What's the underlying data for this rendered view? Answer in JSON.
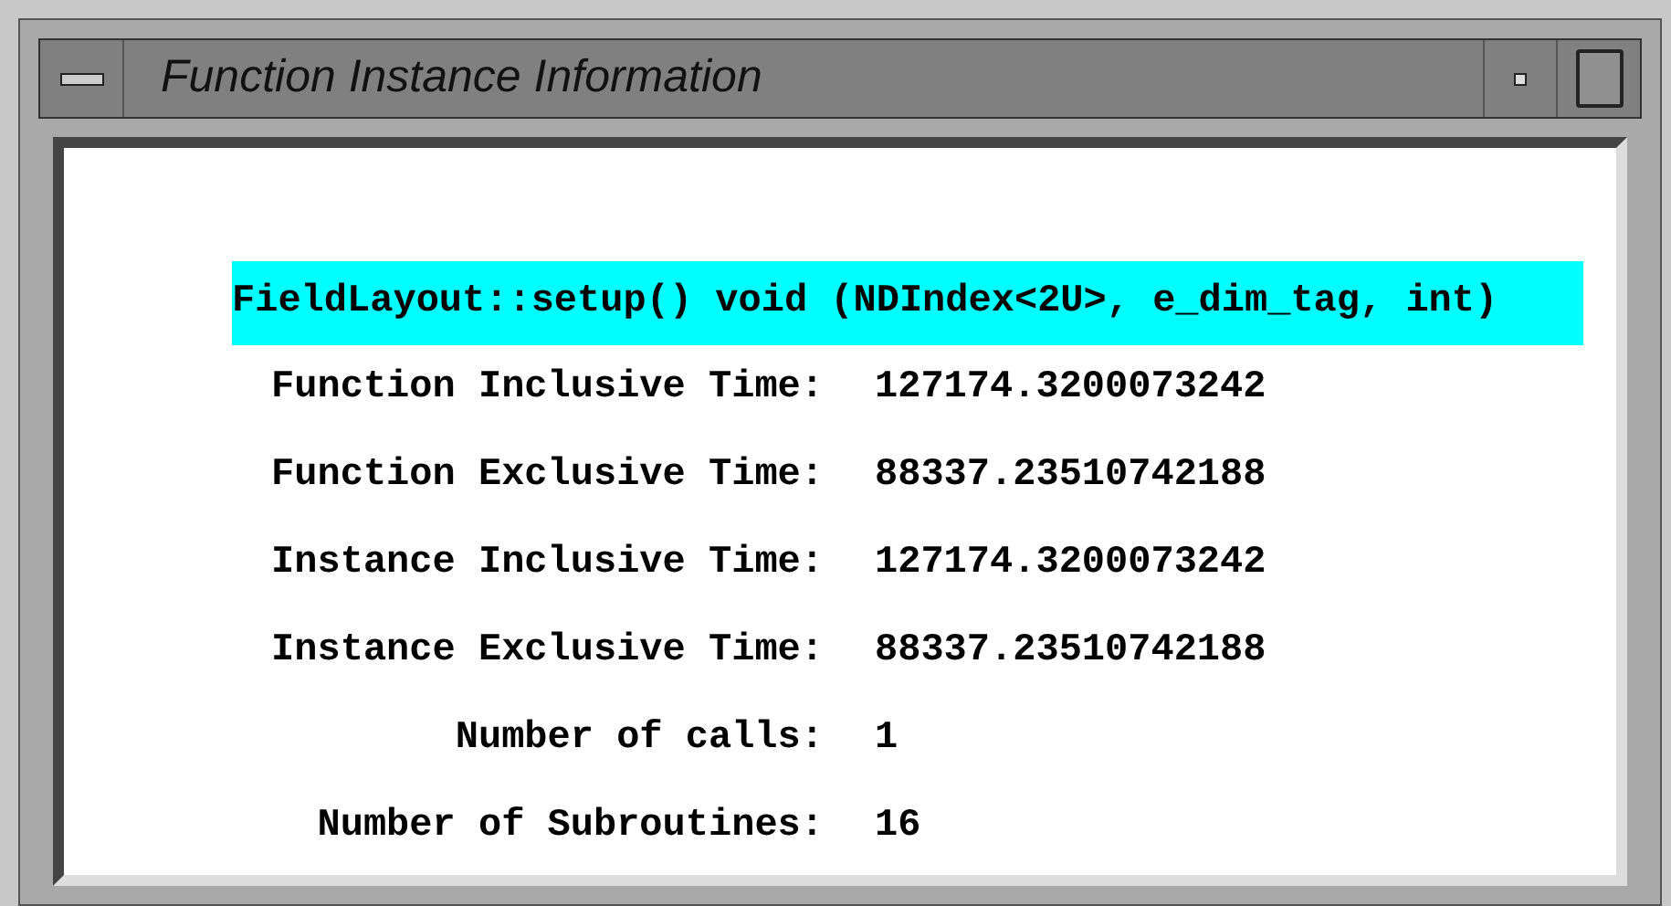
{
  "window": {
    "title": "Function Instance Information"
  },
  "function_signature": {
    "text": "FieldLayout::setup() void (NDIndex<2U>, e_dim_tag, int)",
    "selected": true
  },
  "rows": [
    {
      "label": "Function Inclusive Time:",
      "value": "127174.3200073242"
    },
    {
      "label": "Function Exclusive Time:",
      "value": "88337.23510742188"
    },
    {
      "label": "Instance Inclusive Time:",
      "value": "127174.3200073242"
    },
    {
      "label": "Instance Exclusive Time:",
      "value": "88337.23510742188"
    },
    {
      "label": "Number of calls:",
      "value": "1"
    },
    {
      "label": "Number of Subroutines:",
      "value": "16"
    }
  ]
}
